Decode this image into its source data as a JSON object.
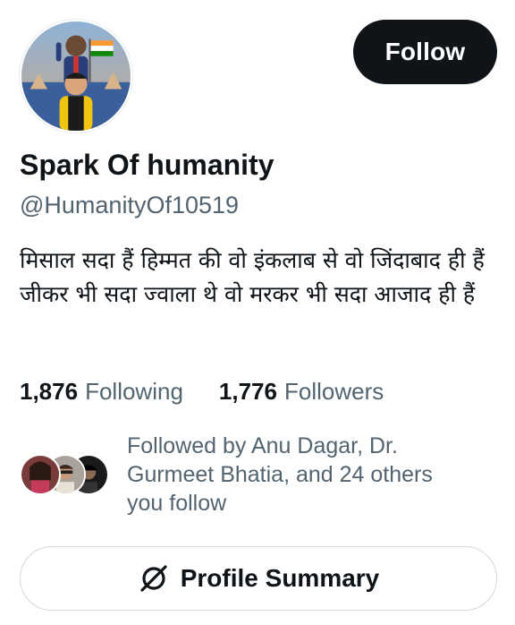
{
  "profile": {
    "display_name": "Spark Of humanity",
    "handle": "@HumanityOf10519",
    "bio": "मिसाल सदा हैं हिम्मत की वो इंकलाब से वो जिंदाबाद ही हैं जीकर भी सदा ज्वाला थे वो मरकर भी सदा आजाद ही हैं",
    "avatar_icon": "profile-photo"
  },
  "actions": {
    "follow_label": "Follow",
    "summary_label": "Profile Summary",
    "summary_icon": "grok-slash-icon"
  },
  "stats": {
    "following_count": "1,876",
    "following_label": "Following",
    "followers_count": "1,776",
    "followers_label": "Followers"
  },
  "followed_by": {
    "text": "Followed by Anu Dagar, Dr. Gurmeet Bhatia, and 24 others you follow"
  },
  "colors": {
    "text_primary": "#0f1419",
    "text_secondary": "#536471",
    "button_dark": "#0f1419",
    "border": "#cfd9de"
  }
}
